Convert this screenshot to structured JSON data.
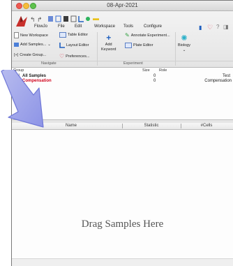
{
  "window": {
    "title": "08-Apr-2021"
  },
  "menu": {
    "tabs": [
      "FlowJo",
      "File",
      "Edit",
      "Workspace",
      "Tools",
      "Configure"
    ]
  },
  "ribbon": {
    "navigate": {
      "label": "Navigate",
      "new_workspace": "New Workspace",
      "add_samples": "Add Samples...",
      "create_group": "Create Group...",
      "table_editor": "Table Editor",
      "layout_editor": "Layout Editor",
      "preferences": "Preferences..."
    },
    "experiment": {
      "label": "Experiment",
      "add_keyword_line1": "Add",
      "add_keyword_line2": "Keyword",
      "annotate": "Annotate Experiment...",
      "plate_editor": "Plate Editor"
    },
    "biology": {
      "label": "Biology"
    }
  },
  "groups": {
    "headers": {
      "group": "Group",
      "size": "Size",
      "role": "Role"
    },
    "rows": [
      {
        "name": "All Samples",
        "size": "0",
        "role": "Test",
        "color": "#1a1a1a"
      },
      {
        "name": "Compensation",
        "size": "0",
        "role": "Compensation",
        "color": "#d0021b"
      }
    ]
  },
  "stats": {
    "headers": {
      "name": "Name",
      "statistic": "Statistic",
      "cells": "#Cells"
    }
  },
  "main": {
    "placeholder": "Drag Samples Here"
  }
}
